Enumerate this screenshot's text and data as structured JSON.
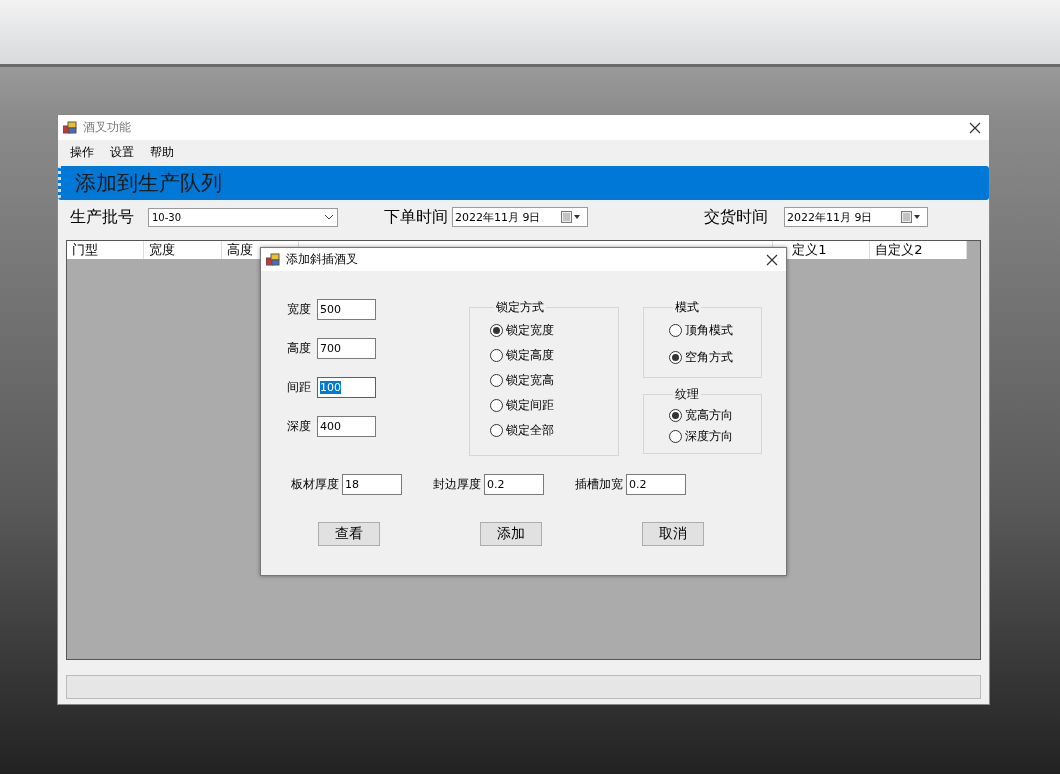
{
  "window": {
    "title": "酒叉功能"
  },
  "menu": [
    "操作",
    "设置",
    "帮助"
  ],
  "banner": {
    "title": "添加到生产队列"
  },
  "filters": {
    "batch": {
      "label": "生产批号",
      "value": "10-30"
    },
    "order_date": {
      "label": "下单时间",
      "value": "2022年11月 9日"
    },
    "delivery_date": {
      "label": "交货时间",
      "value": "2022年11月 9日"
    }
  },
  "table": {
    "columns": [
      "门型",
      "宽度",
      "高度",
      "定义1",
      "自定义2"
    ]
  },
  "dialog": {
    "title": "添加斜插酒叉",
    "fields": [
      {
        "label": "宽度",
        "value": "500",
        "selected": false
      },
      {
        "label": "高度",
        "value": "700",
        "selected": false
      },
      {
        "label": "间距",
        "value": "100",
        "selected": true
      },
      {
        "label": "深度",
        "value": "400",
        "selected": false
      }
    ],
    "lock_group": {
      "title": "锁定方式",
      "options": [
        {
          "label": "锁定宽度",
          "selected": true
        },
        {
          "label": "锁定高度",
          "selected": false
        },
        {
          "label": "锁定宽高",
          "selected": false
        },
        {
          "label": "锁定间距",
          "selected": false
        },
        {
          "label": "锁定全部",
          "selected": false
        }
      ]
    },
    "mode_group": {
      "title": "模式",
      "options": [
        {
          "label": "顶角模式",
          "selected": false
        },
        {
          "label": "空角方式",
          "selected": true
        }
      ]
    },
    "texture_group": {
      "title": "纹理",
      "options": [
        {
          "label": "宽高方向",
          "selected": true
        },
        {
          "label": "深度方向",
          "selected": false
        }
      ]
    },
    "bottom_fields": [
      {
        "label": "板材厚度",
        "value": "18"
      },
      {
        "label": "封边厚度",
        "value": "0.2"
      },
      {
        "label": "插槽加宽",
        "value": "0.2"
      }
    ],
    "buttons": [
      "查看",
      "添加",
      "取消"
    ]
  }
}
